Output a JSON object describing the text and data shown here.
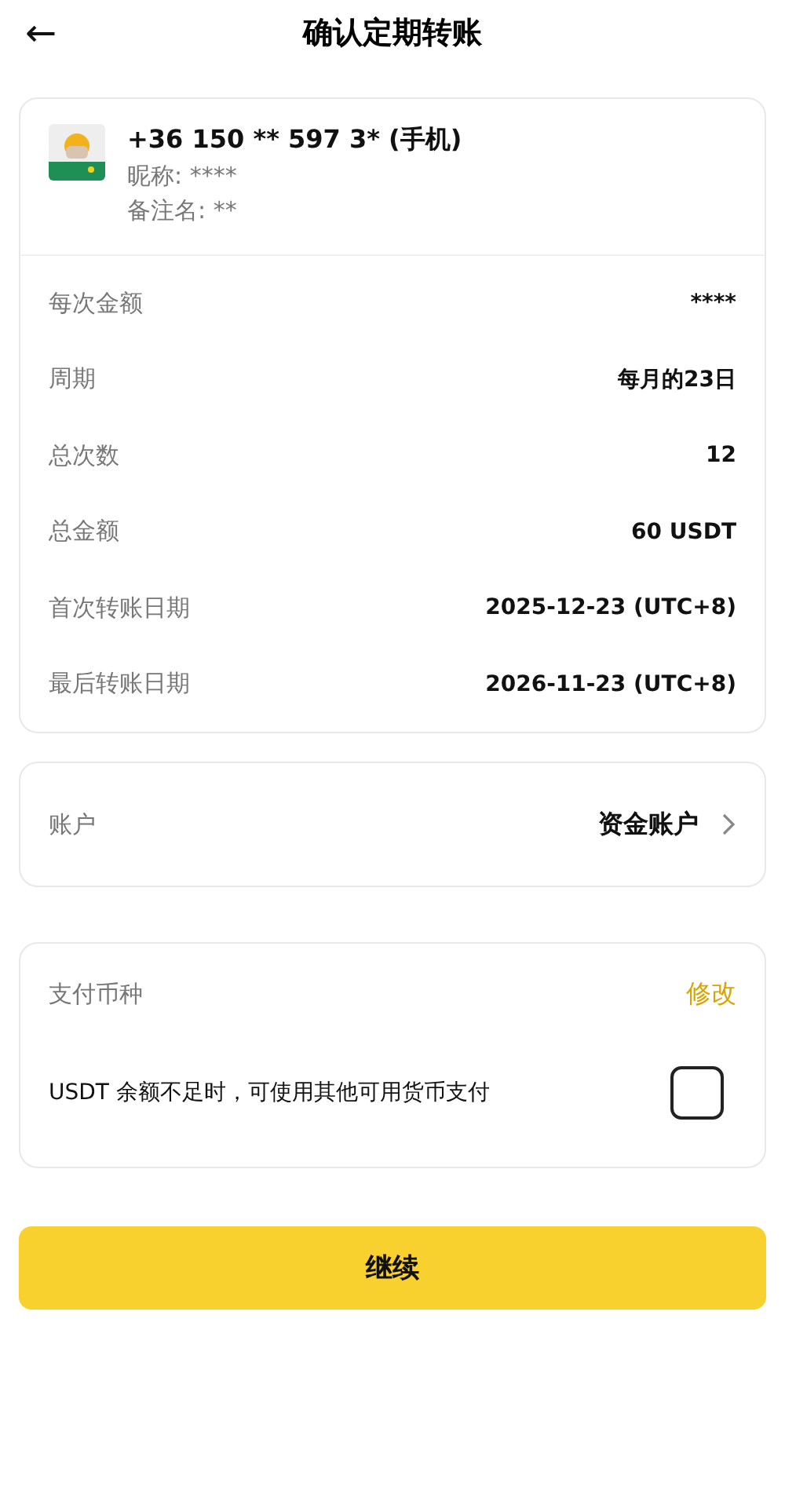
{
  "header": {
    "back_icon": "←",
    "title": "确认定期转账"
  },
  "recipient": {
    "phone": "+36 150 ** 597 3* (手机)",
    "nickname": "昵称: ****",
    "remark": "备注名: **"
  },
  "details": [
    {
      "label": "每次金额",
      "value": "****"
    },
    {
      "label": "周期",
      "value": "每月的23日"
    },
    {
      "label": "总次数",
      "value": "12"
    },
    {
      "label": "总金额",
      "value": "60 USDT"
    },
    {
      "label": "首次转账日期",
      "value": "2025-12-23 (UTC+8)"
    },
    {
      "label": "最后转账日期",
      "value": "2026-11-23 (UTC+8)"
    }
  ],
  "account": {
    "label": "账户",
    "value": "资金账户"
  },
  "payment": {
    "label": "支付币种",
    "action": "修改",
    "option": "USDT 余额不足时，可使用其他可用货币支付",
    "checked": false
  },
  "continue_button": "继续"
}
